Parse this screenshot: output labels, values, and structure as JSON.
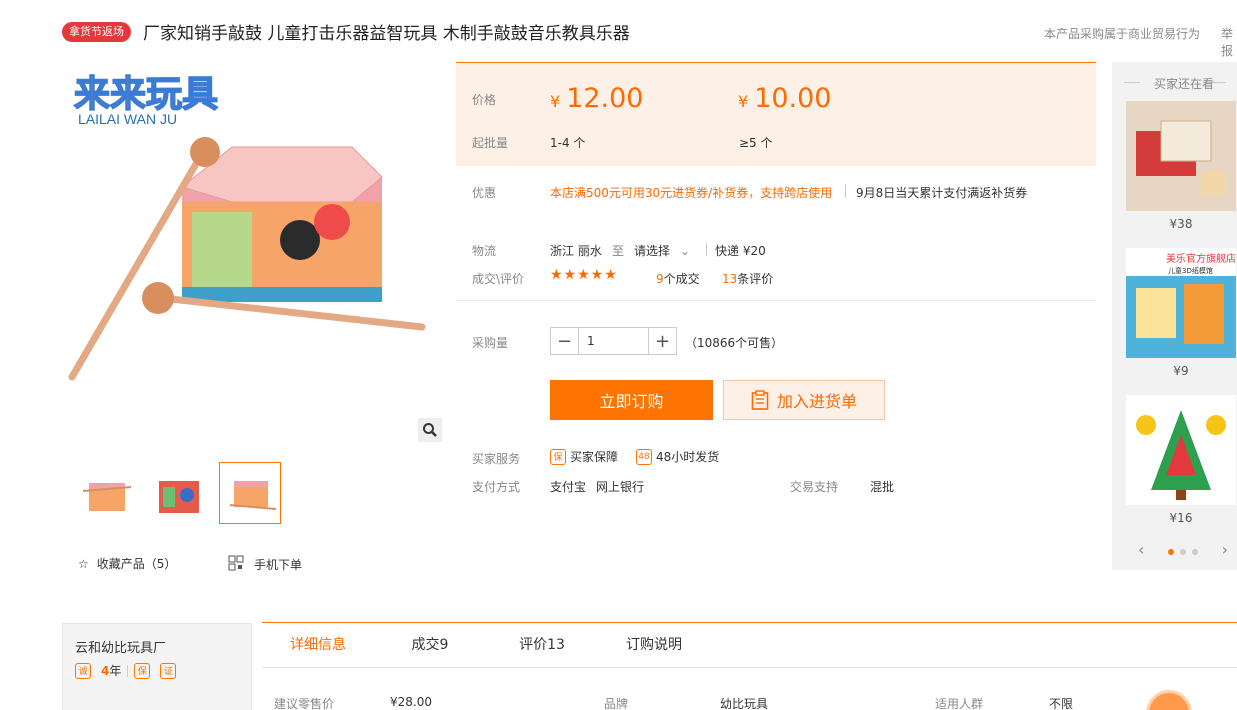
{
  "header": {
    "badge": "拿货节返场",
    "title": "厂家知销手敲鼓 儿童打击乐器益智玩具 木制手敲鼓音乐教具乐器",
    "note": "本产品采购属于商业贸易行为",
    "report": "举报"
  },
  "gallery": {
    "brand_logo": "来来玩具",
    "brand_logo_en": "LAILAI WAN JU",
    "zoom_icon": "search-icon",
    "favorite": "收藏产品（5）",
    "mobile_order": "手机下单"
  },
  "pricing": {
    "price_label": "价格",
    "currency": "¥",
    "tier1_price": "12.00",
    "tier2_price": "10.00",
    "moq_label": "起批量",
    "tier1_qty": "1-4 个",
    "tier2_qty": "≥5 个"
  },
  "promo": {
    "label": "优惠",
    "coupon": "本店满500元可用30元进货券/补货券，支持跨店使用",
    "rebate": "9月8日当天累计支付满返补货券"
  },
  "logistics": {
    "label": "物流",
    "from": "浙江 丽水",
    "to_sep": "至",
    "to": "请选择",
    "express": "快递 ¥20"
  },
  "reviews": {
    "label": "成交\\评价",
    "stars": "★★★★★",
    "deals_count": "9",
    "deals_text": "个成交",
    "reviews_count": "13",
    "reviews_text": "条评价"
  },
  "purchase": {
    "label": "采购量",
    "minus": "−",
    "qty": "1",
    "plus": "+",
    "stock": "（10866个可售）",
    "buy_now": "立即订购",
    "add_cart": "加入进货单"
  },
  "services": {
    "label": "买家服务",
    "guarantee_icon": "保",
    "guarantee": "买家保障",
    "ship_icon": "48",
    "ship48": "48小时发货",
    "pay_label": "支付方式",
    "pay1": "支付宝",
    "pay2": "网上银行",
    "trade_label": "交易支持",
    "trade_val": "混批"
  },
  "sidebar": {
    "title": "买家还在看",
    "items": [
      {
        "price": "¥38"
      },
      {
        "price": "¥9",
        "store_label": "美乐官方旗舰店",
        "store_sub": "儿童3D纸模馆"
      },
      {
        "price": "¥16"
      }
    ]
  },
  "shop": {
    "name": "云和幼比玩具厂",
    "years": "4",
    "years_unit": "年"
  },
  "tabs": [
    "详细信息",
    "成交9",
    "评价13",
    "订购说明"
  ],
  "props": {
    "retail_label": "建议零售价",
    "retail_val": "¥28.00",
    "brand_label": "品牌",
    "brand_val": "幼比玩具",
    "audience_label": "适用人群",
    "audience_val": "不限"
  },
  "colors": {
    "accent": "#ff7300",
    "price_bg": "#fdf0e7",
    "badge": "#e4393c"
  }
}
